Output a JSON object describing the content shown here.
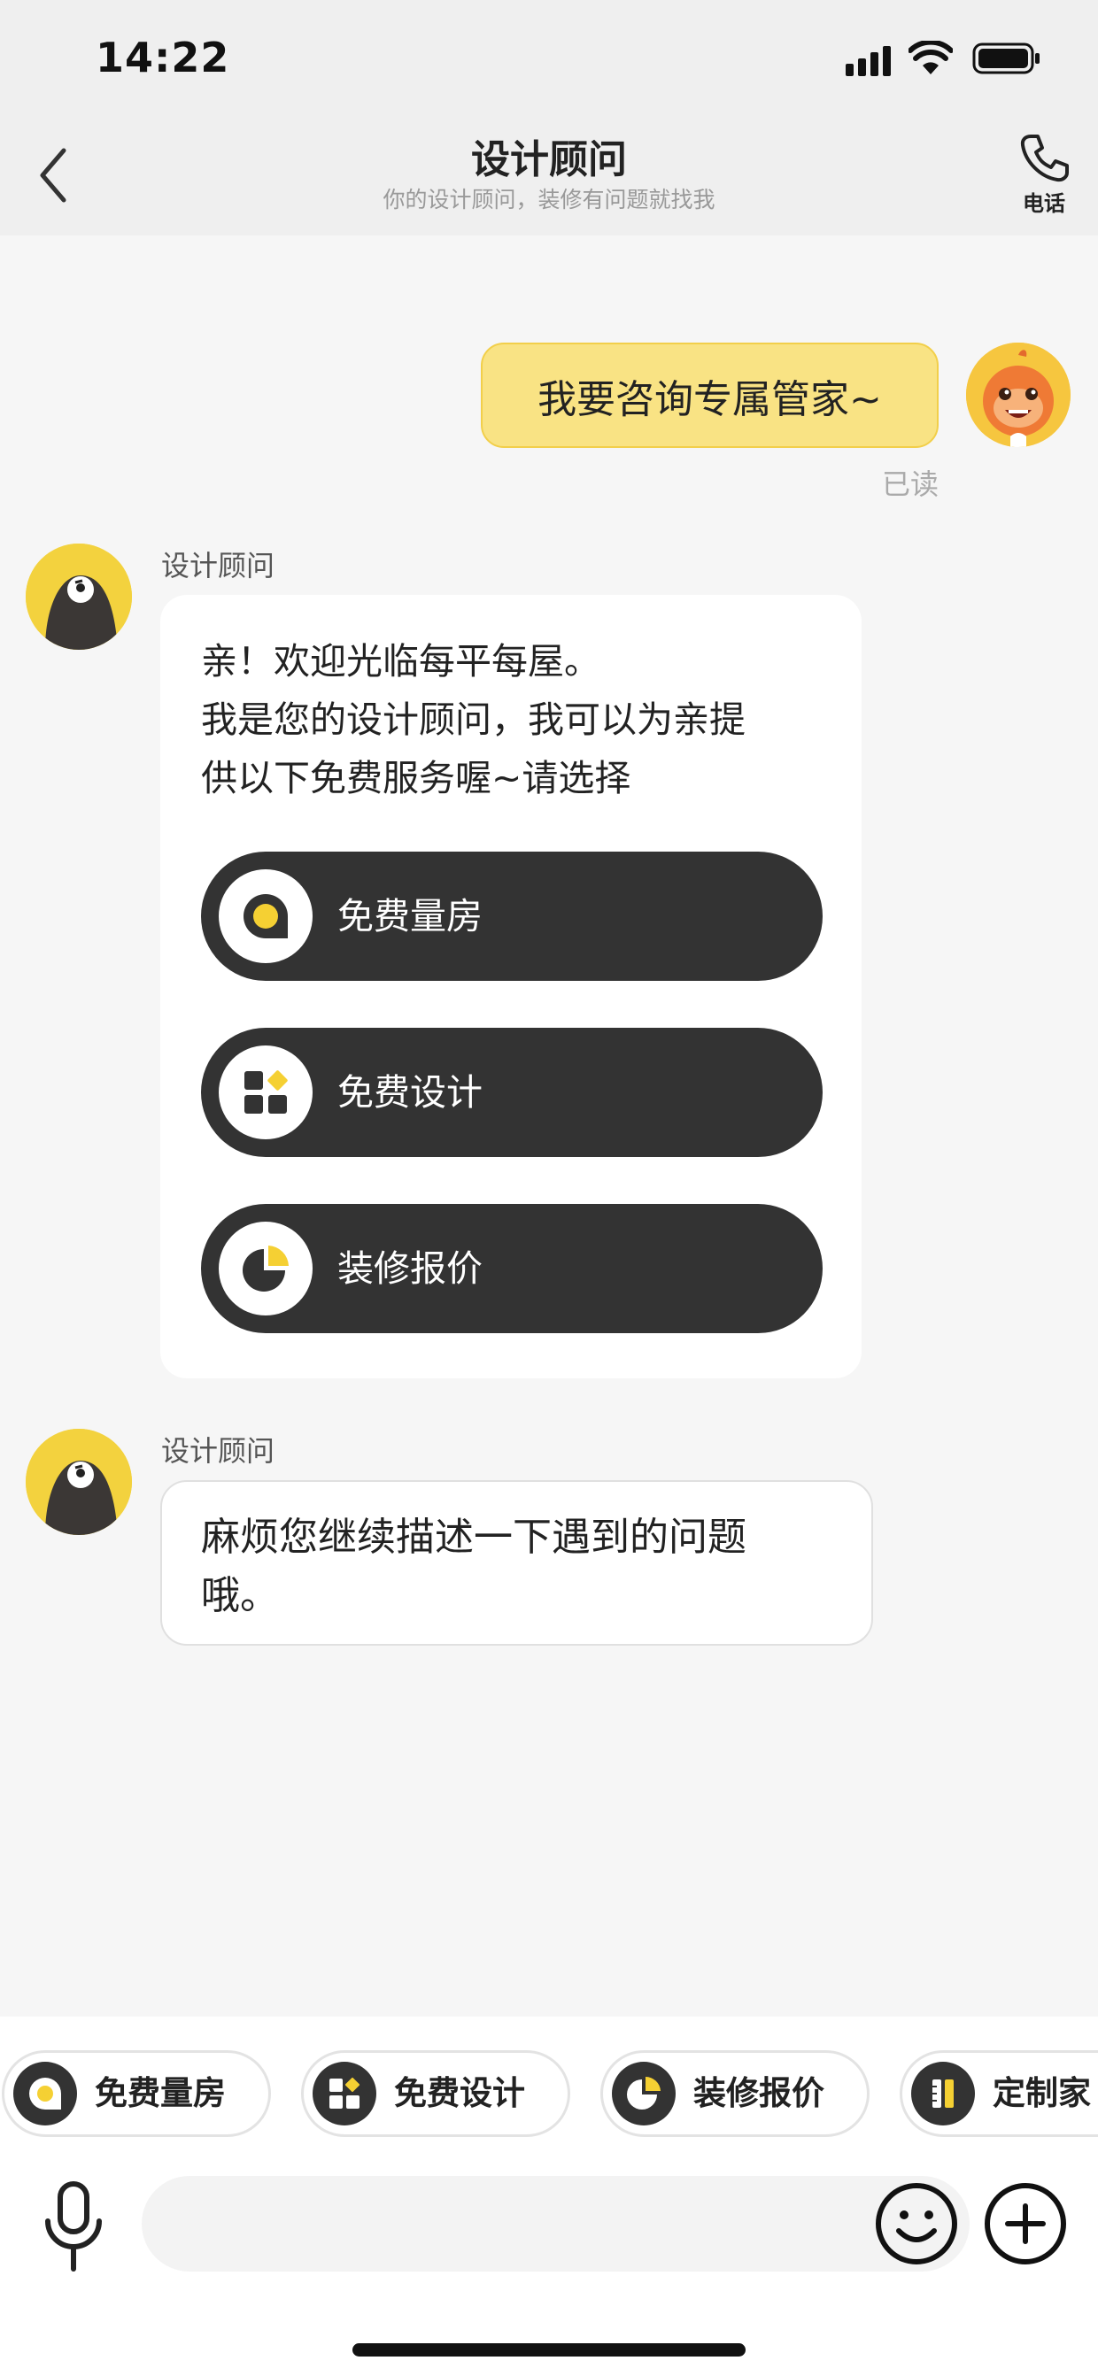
{
  "status_bar": {
    "time": "14:22"
  },
  "nav": {
    "title": "设计顾问",
    "subtitle": "你的设计顾问，装修有问题就找我",
    "phone_label": "电话"
  },
  "messages": {
    "user_message": "我要咨询专属管家~",
    "read_status": "已读",
    "bot_name": "设计顾问",
    "welcome_lines": [
      "亲！欢迎光临每平每屋。",
      "我是您的设计顾问，我可以为亲提",
      "供以下免费服务喔~请选择"
    ],
    "services": [
      {
        "label": "免费量房",
        "icon": "tape-measure-icon"
      },
      {
        "label": "免费设计",
        "icon": "grid-design-icon"
      },
      {
        "label": "装修报价",
        "icon": "pie-chart-icon"
      }
    ],
    "bot_name_2": "设计顾问",
    "followup_lines": [
      "麻烦您继续描述一下遇到的问题",
      "哦。"
    ]
  },
  "quick_chips": [
    {
      "label": "免费量房",
      "icon": "tape-measure-icon"
    },
    {
      "label": "免费设计",
      "icon": "grid-design-icon"
    },
    {
      "label": "装修报价",
      "icon": "pie-chart-icon"
    },
    {
      "label": "定制家",
      "icon": "ruler-icon"
    }
  ],
  "input": {
    "placeholder": ""
  },
  "colors": {
    "accent": "#f9e384",
    "accent_border": "#f2cf4a",
    "dark": "#333333",
    "yellow": "#f5d033"
  }
}
